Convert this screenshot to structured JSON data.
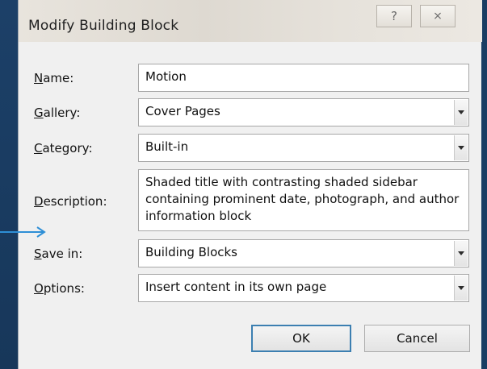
{
  "dialog": {
    "title": "Modify Building Block",
    "help_icon": "?",
    "close_icon": "⨯"
  },
  "fields": {
    "name": {
      "label_ul": "N",
      "label_rest": "ame:",
      "value": "Motion"
    },
    "gallery": {
      "label_ul": "G",
      "label_rest": "allery:",
      "value": "Cover Pages"
    },
    "category": {
      "label_ul": "C",
      "label_rest": "ategory:",
      "value": "Built-in"
    },
    "description": {
      "label_ul": "D",
      "label_rest": "escription:",
      "value": "Shaded title with contrasting shaded sidebar containing prominent date, photograph, and author information block"
    },
    "save_in": {
      "label_ul": "S",
      "label_rest": "ave in:",
      "value": "Building Blocks"
    },
    "options": {
      "label_ul": "O",
      "label_rest": "ptions:",
      "value": "Insert content in its own page"
    }
  },
  "buttons": {
    "ok": "OK",
    "cancel": "Cancel"
  },
  "colors": {
    "background": "#1a3d63",
    "ok_border": "#3c7fb1",
    "annotation_arrow": "#2e8fd6"
  }
}
